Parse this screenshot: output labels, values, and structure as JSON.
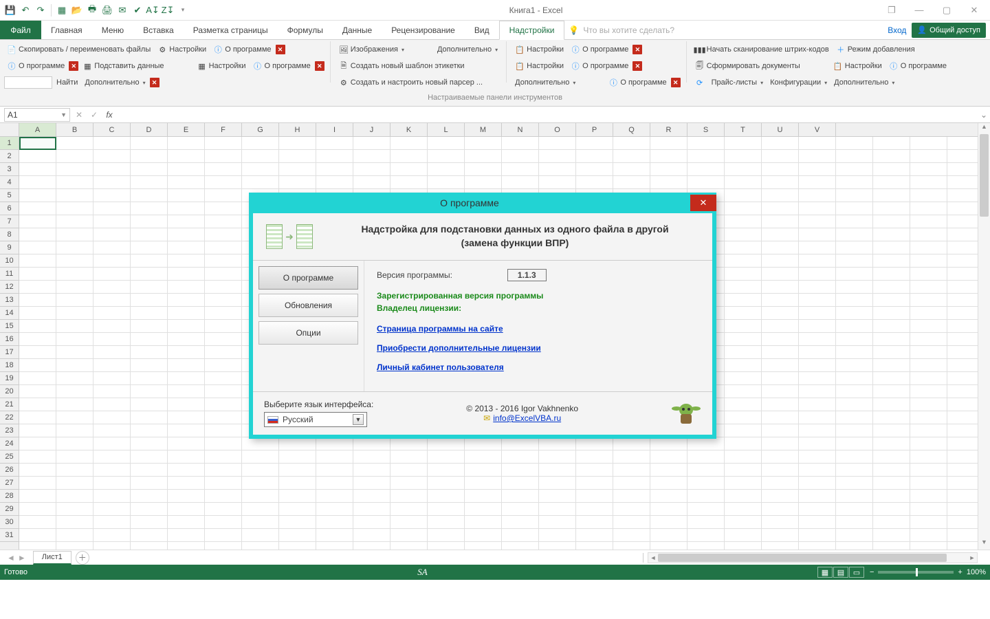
{
  "title": "Книга1 - Excel",
  "win": {
    "min": "—",
    "max": "▢",
    "close": "✕",
    "restore": "❐"
  },
  "tabs": {
    "file": "Файл",
    "home": "Главная",
    "menu": "Меню",
    "insert": "Вставка",
    "layout": "Разметка страницы",
    "formulas": "Формулы",
    "data": "Данные",
    "review": "Рецензирование",
    "view": "Вид",
    "addins": "Надстройки"
  },
  "tellme": "Что вы хотите сделать?",
  "login": "Вход",
  "share": "Общий доступ",
  "ribbon": {
    "copy_rename": "Скопировать / переименовать файлы",
    "settings": "Настройки",
    "about": "О программе",
    "subst": "Подставить данные",
    "search": "Найти",
    "extra": "Дополнительно",
    "images": "Изображения",
    "new_tpl": "Создать новый шаблон этикетки",
    "parser": "Создать и настроить новый парсер ...",
    "scan": "Начать сканирование штрих-кодов",
    "add_mode": "Режим добавления",
    "form_docs": "Сформировать документы",
    "prices": "Прайс-листы",
    "configs": "Конфигурации",
    "caption": "Настраиваемые панели инструментов"
  },
  "namebox": "A1",
  "columns": [
    "A",
    "B",
    "C",
    "D",
    "E",
    "F",
    "G",
    "H",
    "I",
    "J",
    "K",
    "L",
    "M",
    "N",
    "O",
    "P",
    "Q",
    "R",
    "S",
    "T",
    "U",
    "V"
  ],
  "rows": [
    "1",
    "2",
    "3",
    "4",
    "5",
    "6",
    "7",
    "8",
    "9",
    "10",
    "11",
    "12",
    "13",
    "14",
    "15",
    "16",
    "17",
    "18",
    "19",
    "20",
    "21",
    "22",
    "23",
    "24",
    "25",
    "26",
    "27",
    "28",
    "29",
    "30",
    "31"
  ],
  "sheet": {
    "tab": "Лист1"
  },
  "status": {
    "ready": "Готово",
    "sa": "SA",
    "zoom": "100%"
  },
  "dialog": {
    "title": "О программе",
    "head1": "Надстройка для подстановки данных из одного файла в другой",
    "head2": "(замена функции ВПР)",
    "side_about": "О программе",
    "side_updates": "Обновления",
    "side_options": "Опции",
    "ver_label": "Версия программы:",
    "ver": "1.1.3",
    "reg1": "Зарегистрированная версия программы",
    "reg2": "Владелец лицензии:",
    "link_page": "Страница программы на сайте",
    "link_buy": "Приобрести дополнительные лицензии",
    "link_lk": "Личный кабинет пользователя",
    "lang_label": "Выберите язык интерфейса:",
    "lang": "Русский",
    "copyright": "© 2013 - 2016  Igor Vakhnenko",
    "email": "info@ExcelVBA.ru"
  }
}
